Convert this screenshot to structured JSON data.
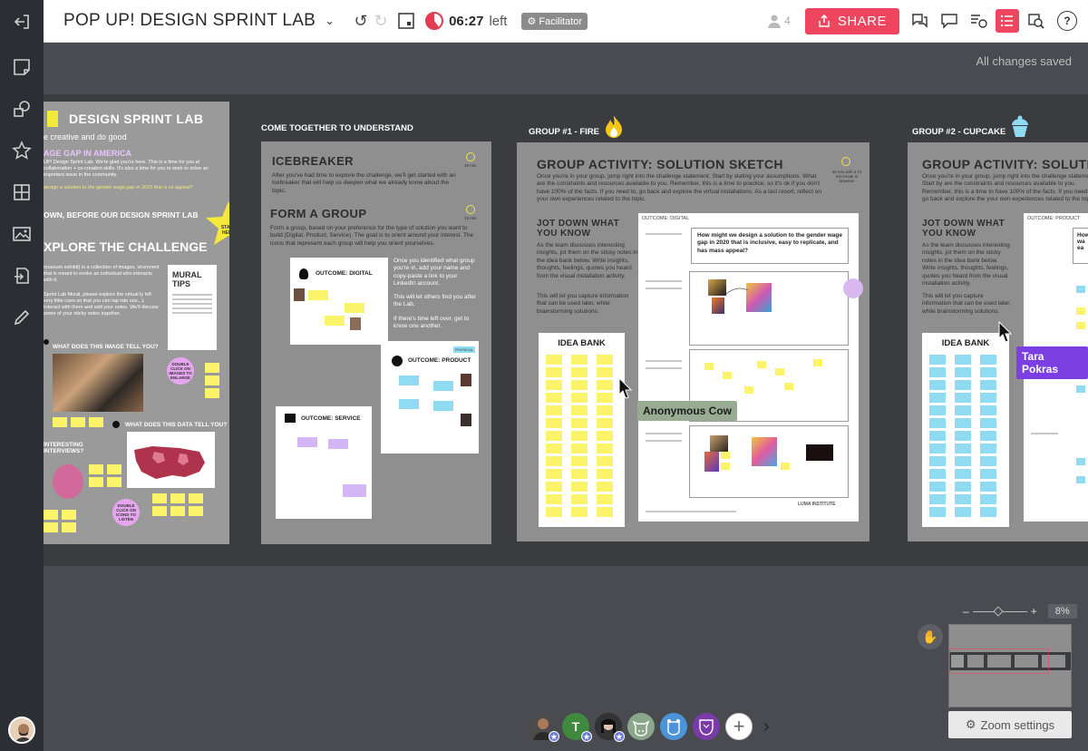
{
  "app": {
    "board_title": "POP UP! DESIGN SPRINT LAB",
    "timer": "06:27",
    "timer_suffix": "left",
    "facilitator_badge": "Facilitator",
    "people_count": "4",
    "share_label": "SHARE",
    "saved_status": "All changes saved"
  },
  "panels": {
    "intro": {
      "title": "DESIGN SPRINT LAB",
      "tagline": "e creative and do good",
      "subtitle": "AGE GAP IN AMERICA",
      "body": "UP! Design Sprint Lab. We're glad you're here. This is a time for you al collaboration + co-creation skills. It's also a time for you to work to solve an important issue in the community.",
      "question": "design a solution to the gender wage gap in 2020 that is ss appeal?",
      "section_heading": "OWN, BEFORE OUR DESIGN SPRINT LAB",
      "explore": "XPLORE THE CHALLENGE",
      "start_here": "START HERE",
      "explore_body": "museum exhibit) is a collection of images, vironment that is meant to evoke an individual who interacts with it.",
      "explore_body2": "Sprint Lab Mural, please explore the virtual ly left very little cues so that you can tap into ose...). Interact with them and add your notes. We'll discuss some of your sticky notes together.",
      "mural_tips": "MURAL TIPS",
      "q1": "WHAT DOES THIS IMAGE TELL YOU?",
      "q2": "WHAT DOES THIS DATA TELL YOU?",
      "interviews": "INTERESTING INTERVIEWS?",
      "double_click_enlarge": "DOUBLE CLICK ON IMAGES TO ENLARGE",
      "double_click_listen": "DOUBLE CLICK ON ICONS TO LISTEN"
    },
    "understand": {
      "header": "COME TOGETHER TO UNDERSTAND",
      "icebreaker": "ICEBREAKER",
      "icebreaker_body": "After you've had time to explore the challenge, we'll get started with an Icebreaker that will help us deepen what we already know about the topic.",
      "icebreaker_time": "10 min",
      "form_group": "FORM A GROUP",
      "form_group_body": "Form a group, based on your preference for the type of solution you want to build (Digital, Product, Service). The goal is to orient around your interest. The icons that represent each group will help you orient yourselves.",
      "form_group_time": "10 min",
      "outcome_digital": "OUTCOME: DIGITAL",
      "outcome_product": "OUTCOME: PRODUCT",
      "outcome_service": "OUTCOME: SERVICE",
      "physical_tag": "PHYSICAL",
      "instructions": "Once you identified what group you're in, add your name and copy-paste a link to your LinkedIn account.",
      "instructions2": "This will let others find you after the Lab.",
      "instructions3": "If there's time left over, get to know one another."
    },
    "fire": {
      "header": "GROUP #1 - FIRE",
      "title": "GROUP ACTIVITY: SOLUTION SKETCH",
      "body": "Once you're in your group, jump right into the challenge statement. Start by stating your assumptions. What are the constraints and resources available to you. Remember, this is a time to practice, so it's ok if you don't have 100% of the facts. If you need to, go back and explore the virtual installations. As a last resort, reflect on your own experiences related to the topic.",
      "time_note": "40 min with a 10 min break in between",
      "jot_title": "JOT DOWN WHAT YOU KNOW",
      "jot_body": "As the team discusses interesting insights, jot them on the sticky notes in the idea bank below. Write insights, thoughts, feelings, quotes you heard from the visual installation activity.",
      "jot_body2": "This will let you capture information that can be used later, while brainstorming solutions.",
      "idea_bank": "IDEA BANK",
      "outcome_label": "OUTCOME: DIGITAL",
      "hmw": "How might we design a solution to the gender wage gap in 2020 that is inclusive, easy to replicate, and has mass appeal?",
      "footer_brand": "LUMA INSTITUTE"
    },
    "cupcake": {
      "header": "GROUP #2 - CUPCAKE",
      "title": "GROUP ACTIVITY: SOLUTIO",
      "body": "Once you're in your group, jump right into the challenge statement. Start by are the constraints and resources available to you. Remember, this is a time to have 100% of the facts. If you need to, go back and explore the your own experiences related to the topic.",
      "jot_title": "JOT DOWN WHAT YOU KNOW",
      "jot_body": "As the team discusses interesting insights, jot them on the sticky notes in the idea bank below. Write insights, thoughts, feelings, quotes you heard from the visual installation activity.",
      "jot_body2": "This will let you capture information that can be used later, while brainstorming solutions.",
      "idea_bank": "IDEA BANK",
      "outcome_label": "OUTCOME: PRODUCT",
      "hmw": "How wa ea"
    }
  },
  "cursors": {
    "anonymous": "Anonymous Cow",
    "tara": "Tara Pokras"
  },
  "collaborators": [
    {
      "initial": "",
      "color": "#3a3a3a",
      "name": "user-photo-1"
    },
    {
      "initial": "T",
      "color": "#3f8a3f",
      "name": "collaborator-t"
    },
    {
      "initial": "",
      "color": "#2a2a2a",
      "name": "user-photo-2"
    },
    {
      "initial": "",
      "color": "#6b8f6b",
      "name": "cow-avatar"
    },
    {
      "initial": "",
      "color": "#4b94d8",
      "name": "hippo-avatar"
    },
    {
      "initial": "",
      "color": "#7a3aa8",
      "name": "mask-avatar"
    }
  ],
  "zoom": {
    "percent": "8%",
    "settings_label": "Zoom settings"
  }
}
